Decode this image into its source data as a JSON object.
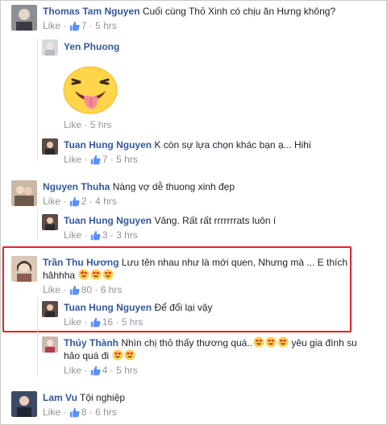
{
  "comments": [
    {
      "name": "Thomas Tam Nguyen",
      "text": "Cuối cùng Thỏ Xinh có chịu ăn Hưng không?",
      "like": "Like",
      "sep": "·",
      "likes": "7",
      "time": "5 hrs",
      "replies": [
        {
          "name": "Yen Phuong",
          "like": "Like",
          "sep": "·",
          "time": "5 hrs"
        },
        {
          "name": "Tuan Hung Nguyen",
          "text": "K còn sự lựa chọn khác bạn ạ... Hihi",
          "like": "Like",
          "sep": "·",
          "likes": "7",
          "time": "5 hrs"
        }
      ]
    },
    {
      "name": "Nguyen Thuha",
      "text": "Nàng vợ dễ thuong xinh đẹp",
      "like": "Like",
      "sep": "·",
      "likes": "2",
      "time": "4 hrs",
      "replies": [
        {
          "name": "Tuan Hung Nguyen",
          "text": "Vâng. Rất rất rrrrrrrats luôn í",
          "like": "Like",
          "sep": "·",
          "likes": "3",
          "time": "3 hrs"
        }
      ]
    },
    {
      "name": "Trần Thu Hương",
      "text": "Lưu tên nhau như là mới quen, Nhưng mà ... E thích",
      "text2": "hâhhha",
      "like": "Like",
      "sep": "·",
      "likes": "80",
      "time": "6 hrs",
      "replies": [
        {
          "name": "Tuan Hung Nguyen",
          "text": "Để đổi lại vậy",
          "like": "Like",
          "sep": "·",
          "likes": "16",
          "time": "5 hrs"
        },
        {
          "name": "Thúy Thành",
          "text": "Nhìn chị thỏ thấy thương quá..",
          "text_after": "yêu gia đình su",
          "text2": "hảo quá đi",
          "like": "Like",
          "sep": "·",
          "likes": "4",
          "time": "5 hrs"
        }
      ]
    },
    {
      "name": "Lam Vu",
      "text": "Tội nghiệp",
      "like": "Like",
      "sep": "·",
      "likes": "8",
      "time": "6 hrs"
    }
  ],
  "colors": {
    "name": "#365899",
    "meta": "#90949c",
    "like_icon": "#5890ff",
    "highlight_border": "#e0242c"
  },
  "icons": {
    "like": "thumbs-up-icon",
    "emoji": "heart-eyes-emoji-icon",
    "sticker": "tongue-out-face-sticker"
  }
}
